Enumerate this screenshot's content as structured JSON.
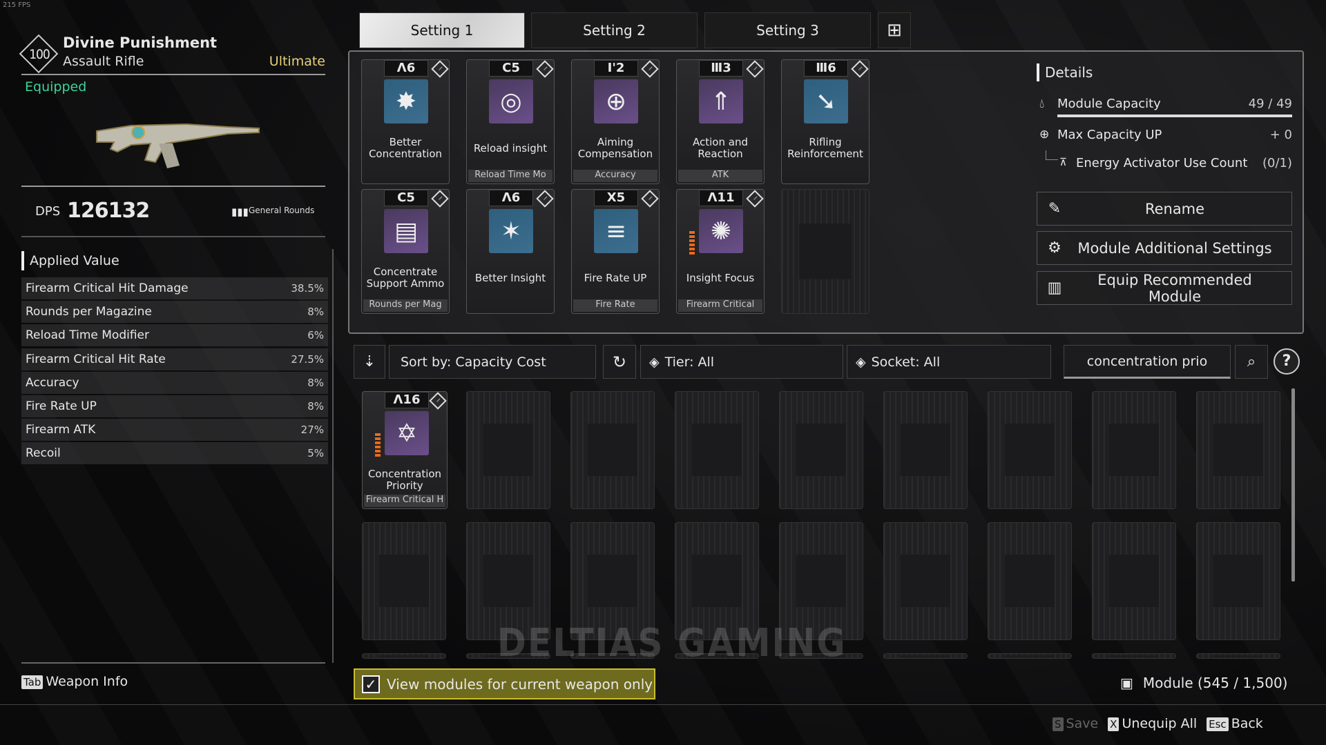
{
  "fps": "215 FPS",
  "weapon": {
    "level": "100",
    "name": "Divine Punishment",
    "type": "Assault Rifle",
    "grade": "Ultimate",
    "status": "Equipped",
    "dps_label": "DPS",
    "dps": "126132",
    "ammo": "General Rounds"
  },
  "applied": {
    "title": "Applied Value",
    "rows": [
      {
        "label": "Firearm Critical Hit Damage",
        "value": "38.5%"
      },
      {
        "label": "Rounds per Magazine",
        "value": "8%"
      },
      {
        "label": "Reload Time Modifier",
        "value": "6%"
      },
      {
        "label": "Firearm Critical Hit Rate",
        "value": "27.5%"
      },
      {
        "label": "Accuracy",
        "value": "8%"
      },
      {
        "label": "Fire Rate UP",
        "value": "8%"
      },
      {
        "label": "Firearm ATK",
        "value": "27%"
      },
      {
        "label": "Recoil",
        "value": "5%"
      }
    ]
  },
  "tabs": [
    "Setting 1",
    "Setting 2",
    "Setting 3"
  ],
  "equipped_modules": [
    {
      "cost": "Λ6",
      "name": "Better Concentration",
      "sub": "",
      "color": "blue"
    },
    {
      "cost": "C5",
      "name": "Reload insight",
      "sub": "Reload Time Mo",
      "color": "purple"
    },
    {
      "cost": "I'2",
      "name": "Aiming Compensation",
      "sub": "Accuracy",
      "color": "purple"
    },
    {
      "cost": "Ⅲ3",
      "name": "Action and Reaction",
      "sub": "ATK",
      "color": "purple"
    },
    {
      "cost": "Ⅲ6",
      "name": "Rifling Reinforcement",
      "sub": "",
      "color": "blue"
    },
    {
      "cost": "C5",
      "name": "Concentrate Support Ammo",
      "sub": "Rounds per Mag",
      "color": "purple"
    },
    {
      "cost": "Λ6",
      "name": "Better Insight",
      "sub": "",
      "color": "blue"
    },
    {
      "cost": "X5",
      "name": "Fire Rate UP",
      "sub": "Fire Rate",
      "color": "blue"
    },
    {
      "cost": "Λ11",
      "name": "Insight Focus",
      "sub": "Firearm Critical",
      "color": "purple"
    }
  ],
  "details": {
    "title": "Details",
    "capacity_label": "Module Capacity",
    "capacity": "49 / 49",
    "capacity_fraction": 1.0,
    "max_label": "Max Capacity UP",
    "max_value": "+ 0",
    "energy_label": "Energy Activator Use Count",
    "energy_value": "(0/1)",
    "rename": "Rename",
    "additional": "Module Additional Settings",
    "recommend": "Equip Recommended Module"
  },
  "filters": {
    "sort": "Sort by: Capacity Cost",
    "tier": "Tier: All",
    "socket": "Socket: All",
    "search": "concentration prio",
    "help": "?"
  },
  "inventory": [
    {
      "cost": "Λ16",
      "name": "Concentration Priority",
      "sub": "Firearm Critical H",
      "color": "purple"
    }
  ],
  "footer": {
    "tab_key": "Tab",
    "weapon_info": "Weapon Info",
    "view_only": "View modules for current weapon only",
    "module_count": "Module (545 / 1,500)",
    "save_key": "S",
    "save": "Save",
    "unequip_key": "X",
    "unequip": "Unequip All",
    "back_key": "Esc",
    "back": "Back"
  },
  "watermark": "DELTIAS GAMING"
}
